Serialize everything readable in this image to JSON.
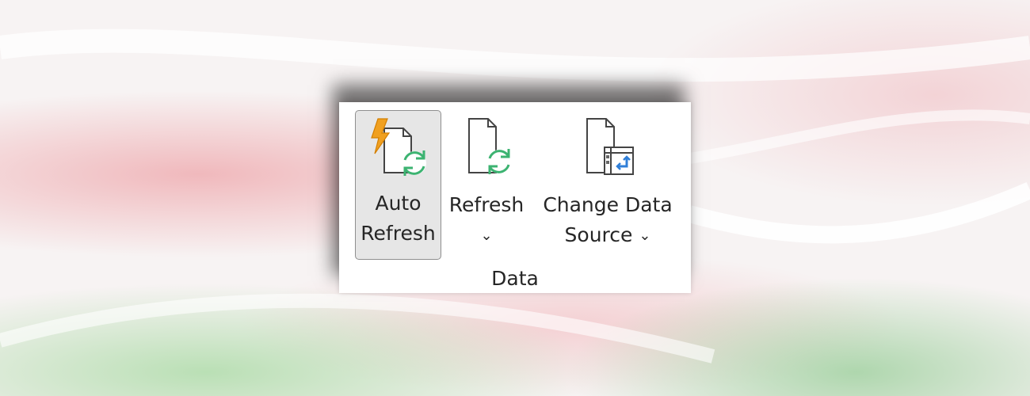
{
  "ribbon_group": {
    "label": "Data",
    "buttons": {
      "auto_refresh": {
        "line1": "Auto",
        "line2": "Refresh",
        "icon": "auto-refresh-icon",
        "state": "pressed"
      },
      "refresh": {
        "line1": "Refresh",
        "chevron": "⌄",
        "icon": "refresh-document-icon"
      },
      "change_data_source": {
        "line1": "Change Data",
        "line2": "Source",
        "chevron": "⌄",
        "icon": "change-data-source-icon"
      }
    }
  },
  "colors": {
    "lightning": "#f0a020",
    "refresh_green": "#3cb371",
    "source_blue": "#2f7fd8",
    "text": "#262626",
    "pressed_bg": "#e6e6e6"
  }
}
